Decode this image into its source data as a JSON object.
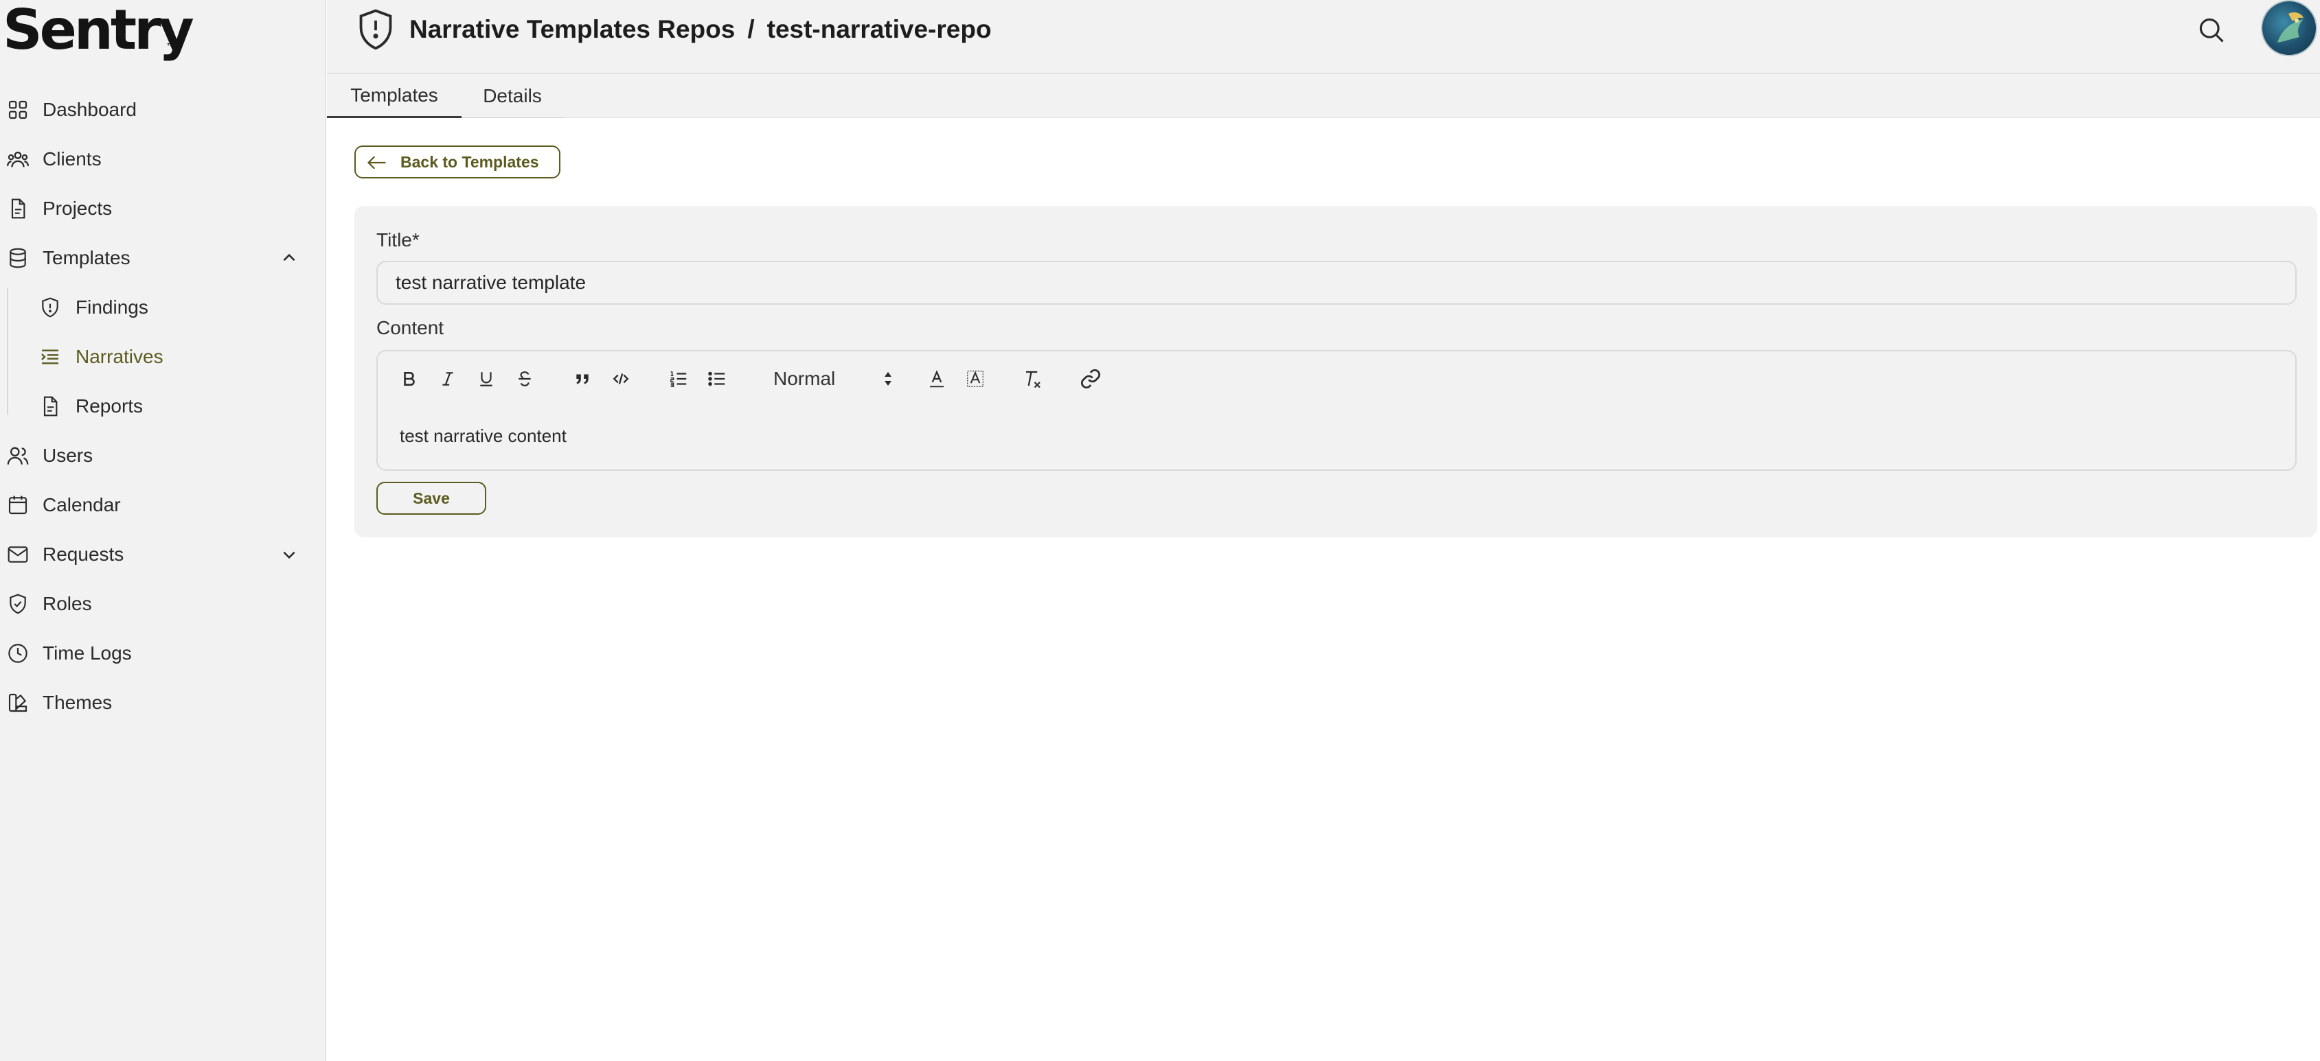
{
  "app": {
    "logo_text": "Sentry",
    "logo_mark": "™"
  },
  "sidebar": {
    "items": [
      {
        "label": "Dashboard",
        "icon": "grid-icon"
      },
      {
        "label": "Clients",
        "icon": "people-icon"
      },
      {
        "label": "Projects",
        "icon": "document-icon"
      },
      {
        "label": "Templates",
        "icon": "database-icon",
        "expanded": true
      },
      {
        "label": "Findings",
        "icon": "shield-alert-icon"
      },
      {
        "label": "Narratives",
        "icon": "list-indent-icon",
        "active": true
      },
      {
        "label": "Reports",
        "icon": "document-icon"
      },
      {
        "label": "Users",
        "icon": "users-icon"
      },
      {
        "label": "Calendar",
        "icon": "calendar-icon"
      },
      {
        "label": "Requests",
        "icon": "mail-icon",
        "expanded": false
      },
      {
        "label": "Roles",
        "icon": "shield-check-icon"
      },
      {
        "label": "Time Logs",
        "icon": "clock-icon"
      },
      {
        "label": "Themes",
        "icon": "swatch-icon"
      }
    ]
  },
  "header": {
    "breadcrumb": [
      "Narrative Templates Repos",
      "/",
      "test-narrative-repo"
    ]
  },
  "tabs": [
    {
      "label": "Templates",
      "selected": true
    },
    {
      "label": "Details",
      "selected": false
    }
  ],
  "main": {
    "back_label": "Back to Templates",
    "title_label": "Title*",
    "title_value": "test narrative template",
    "content_label": "Content",
    "editor": {
      "format_value": "Normal",
      "content": "test narrative content"
    },
    "save_label": "Save"
  },
  "colors": {
    "accent": "#5c5a1e",
    "sidebar_bg": "#f2f2f2",
    "panel_bg": "#f2f2f2"
  }
}
